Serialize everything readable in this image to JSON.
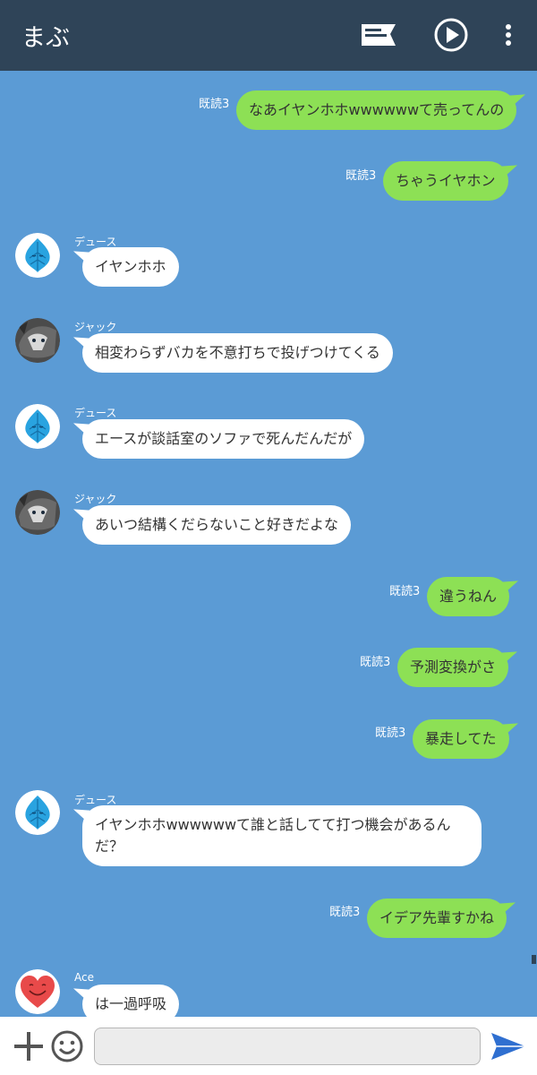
{
  "header": {
    "title": "まぶ",
    "icons": [
      "message-icon",
      "play-icon",
      "more-vertical-icon"
    ]
  },
  "messages": [
    {
      "type": "out",
      "read": "既読3",
      "text": "なあイヤンホホwwwwwwて売ってんの"
    },
    {
      "type": "out",
      "read": "既読3",
      "text": "ちゃうイヤホン"
    },
    {
      "type": "in",
      "sender": "デュース",
      "avatar": "blue-leaf-avatar",
      "text": "イヤンホホ"
    },
    {
      "type": "in",
      "sender": "ジャック",
      "avatar": "wolf-avatar",
      "text": "相変わらずバカを不意打ちで投げつけてくる"
    },
    {
      "type": "in",
      "sender": "デュース",
      "avatar": "blue-leaf-avatar",
      "text": "エースが談話室のソファで死んだんだが"
    },
    {
      "type": "in",
      "sender": "ジャック",
      "avatar": "wolf-avatar",
      "text": "あいつ結構くだらないこと好きだよな"
    },
    {
      "type": "out",
      "read": "既読3",
      "text": "違うねん"
    },
    {
      "type": "out",
      "read": "既読3",
      "text": "予測変換がさ"
    },
    {
      "type": "out",
      "read": "既読3",
      "text": "暴走してた"
    },
    {
      "type": "in",
      "sender": "デュース",
      "avatar": "blue-leaf-avatar",
      "text": "イヤンホホwwwwwwて誰と話してて打つ機会があるんだ？"
    },
    {
      "type": "out",
      "read": "既読3",
      "text": "イデア先輩すかね"
    },
    {
      "type": "in",
      "sender": "Ace",
      "avatar": "heart-avatar",
      "text": "は一過呼吸"
    }
  ],
  "footer": {
    "input_value": "",
    "icons": [
      "plus-icon",
      "emoji-icon",
      "send-icon"
    ]
  },
  "colors": {
    "header_bg": "#2f4458",
    "chat_bg": "#5b9bd5",
    "outgoing_bubble": "#8de055",
    "incoming_bubble": "#ffffff",
    "send_icon": "#2f6fd0"
  }
}
